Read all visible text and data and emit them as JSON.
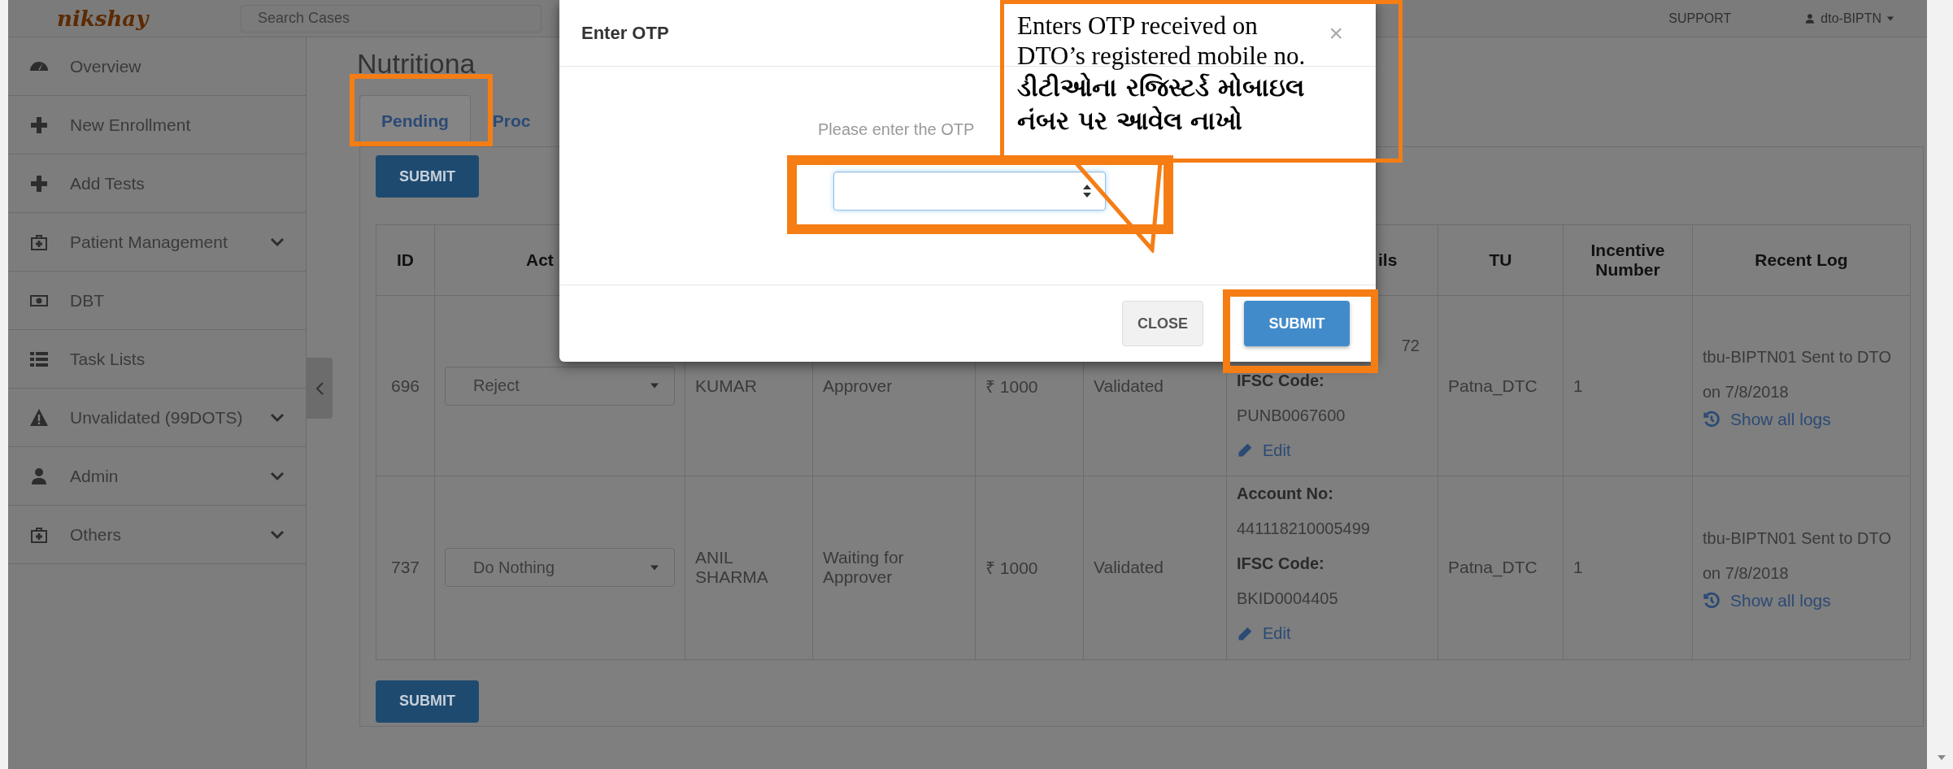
{
  "top_bar": {
    "logo": "nikshay",
    "search": {
      "placeholder": "Search Cases"
    },
    "support": "SUPPORT",
    "user": "dto-BIPTN"
  },
  "sidebar": {
    "items": [
      {
        "label": "Overview",
        "expandable": false
      },
      {
        "label": "New Enrollment",
        "expandable": false
      },
      {
        "label": "Add Tests",
        "expandable": false
      },
      {
        "label": "Patient Management",
        "expandable": true
      },
      {
        "label": "DBT",
        "expandable": false
      },
      {
        "label": "Task Lists",
        "expandable": false
      },
      {
        "label": "Unvalidated (99DOTS)",
        "expandable": true
      },
      {
        "label": "Admin",
        "expandable": true
      },
      {
        "label": "Others",
        "expandable": true
      }
    ]
  },
  "page_title": "Nutritiona",
  "tabs": [
    {
      "label": "Pending",
      "selected": true
    },
    {
      "label": "Proc",
      "selected": false
    }
  ],
  "submit_top": "SUBMIT",
  "table": {
    "columns": [
      "ID",
      "Act",
      "ils",
      "TU",
      "Incentive Number",
      "Recent Log"
    ],
    "rows": [
      {
        "id": "696",
        "action": "Reject",
        "name": "KUMAR",
        "status": "Approver",
        "amount": "₹ 1000",
        "validation": "Validated",
        "bank": [
          {
            "kind": "fragment",
            "text": "72"
          },
          {
            "kind": "label",
            "text": "IFSC Code:"
          },
          {
            "kind": "value",
            "text": "PUNB0067600"
          },
          {
            "kind": "link",
            "text": "Edit"
          }
        ],
        "tu": "Patna_DTC",
        "incentive": "1",
        "log": "tbu-BIPTN01 Sent to DTO on 7/8/2018",
        "log_link": "Show all logs"
      },
      {
        "id": "737",
        "action": "Do Nothing",
        "name": "ANIL SHARMA",
        "status": "Waiting for Approver",
        "amount": "₹ 1000",
        "validation": "Validated",
        "bank": [
          {
            "kind": "label",
            "text": "Account No:"
          },
          {
            "kind": "value",
            "text": "441118210005499"
          },
          {
            "kind": "label",
            "text": "IFSC Code:"
          },
          {
            "kind": "value",
            "text": "BKID0004405"
          },
          {
            "kind": "link",
            "text": "Edit"
          }
        ],
        "tu": "Patna_DTC",
        "incentive": "1",
        "log": "tbu-BIPTN01 Sent to DTO on 7/8/2018",
        "log_link": "Show all logs"
      }
    ]
  },
  "submit_bottom": "SUBMIT",
  "modal": {
    "title": "Enter OTP",
    "close_icon": "×",
    "prompt": "Please enter the OTP",
    "buttons": [
      {
        "label": "CLOSE",
        "kind": "default"
      },
      {
        "label": "SUBMIT",
        "kind": "primary"
      }
    ]
  },
  "callout": {
    "lines": [
      "Enters OTP received on",
      "DTO’s registered mobile no."
    ],
    "translation": "ડીટીઓના રજિસ્ટર્ડ મોબાઇલ નંબર પર આવેલ નાખો"
  }
}
